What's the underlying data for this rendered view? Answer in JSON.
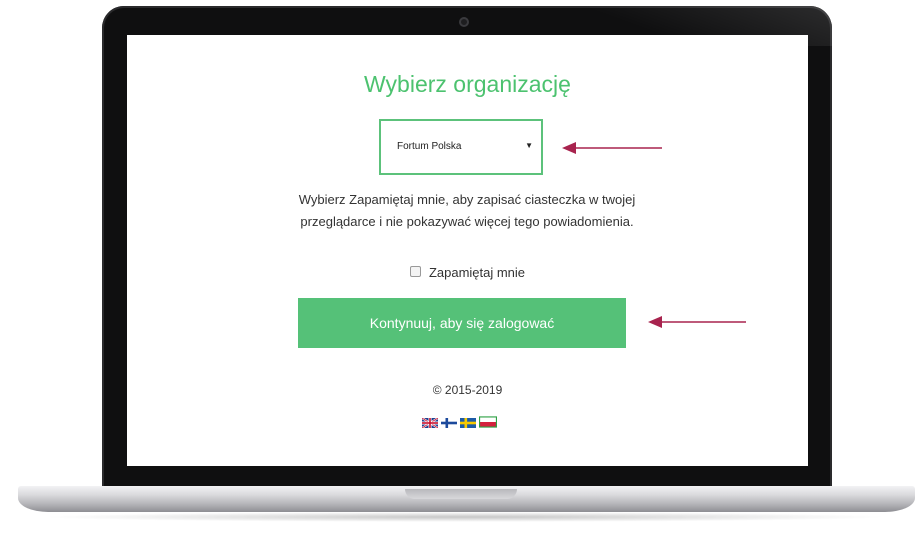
{
  "login": {
    "title": "Wybierz organizację",
    "organization_selected": "Fortum Polska",
    "info_text": "Wybierz Zapamiętaj mnie, aby zapisać ciasteczka w twojej przeglądarce i nie pokazywać więcej tego powiadomienia.",
    "remember_label": "Zapamiętaj mnie",
    "remember_checked": false,
    "continue_label": "Kontynuuj, aby się zalogować",
    "copyright": "© 2015-2019"
  },
  "languages": [
    {
      "icon": "uk-flag-icon"
    },
    {
      "icon": "finland-flag-icon"
    },
    {
      "icon": "sweden-flag-icon"
    },
    {
      "icon": "poland-flag-icon"
    }
  ],
  "colors": {
    "accent": "#4cc26f",
    "button": "#55c178",
    "arrow": "#a8234e",
    "bezel": "#0f0f10"
  }
}
